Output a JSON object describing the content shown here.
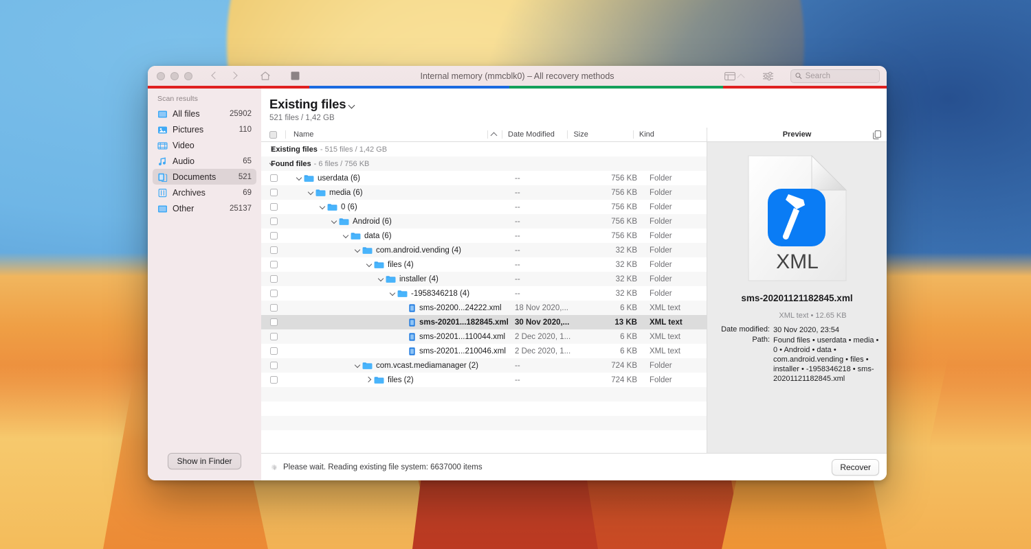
{
  "window": {
    "title": "Internal memory (mmcblk0) – All recovery methods",
    "traffic_lights": [
      "close",
      "minimize",
      "zoom"
    ],
    "toolbar": {
      "back_icon": "chevron-left-icon",
      "forward_icon": "chevron-right-icon",
      "home_icon": "home-icon",
      "stop_icon": "stop-icon",
      "view_icon": "view-options-icon",
      "view_caret": "chevron-down-icon",
      "filter_icon": "filter-sliders-icon",
      "search_icon": "search-icon",
      "search_placeholder": "Search",
      "search_value": ""
    },
    "progress_segments": [
      {
        "color": "#e02020",
        "width_pct": 21.9
      },
      {
        "color": "#1a6ae0",
        "width_pct": 27.0
      },
      {
        "color": "#14a05a",
        "width_pct": 29.0
      },
      {
        "color": "#e02020",
        "width_pct": 22.1
      }
    ]
  },
  "sidebar": {
    "header": "Scan results",
    "items": [
      {
        "label": "All files",
        "count": "25902",
        "icon": "all-files-icon",
        "selected": false
      },
      {
        "label": "Pictures",
        "count": "110",
        "icon": "pictures-icon",
        "selected": false
      },
      {
        "label": "Video",
        "count": "",
        "icon": "video-icon",
        "selected": false
      },
      {
        "label": "Audio",
        "count": "65",
        "icon": "audio-icon",
        "selected": false
      },
      {
        "label": "Documents",
        "count": "521",
        "icon": "documents-icon",
        "selected": true
      },
      {
        "label": "Archives",
        "count": "69",
        "icon": "archives-icon",
        "selected": false
      },
      {
        "label": "Other",
        "count": "25137",
        "icon": "other-icon",
        "selected": false
      }
    ],
    "show_in_finder_label": "Show in Finder"
  },
  "main": {
    "page_title": "Existing files",
    "title_caret": "chevron-down-icon",
    "subtitle": "521 files / 1,42 GB",
    "columns": {
      "name": "Name",
      "date_modified": "Date Modified",
      "size": "Size",
      "kind": "Kind",
      "sort_indicator": "caret-up-icon"
    },
    "groups": [
      {
        "title": "Existing files",
        "sub": "- 515 files / 1,42 GB",
        "expanded": false
      },
      {
        "title": "Found files",
        "sub": "- 6 files / 756 KB",
        "expanded": true
      }
    ],
    "rows": [
      {
        "indent": 0,
        "name": "userdata (6)",
        "date": "--",
        "size": "756 KB",
        "kind": "Folder",
        "type": "folder",
        "expanded": true,
        "selected": false
      },
      {
        "indent": 1,
        "name": "media (6)",
        "date": "--",
        "size": "756 KB",
        "kind": "Folder",
        "type": "folder",
        "expanded": true,
        "selected": false
      },
      {
        "indent": 2,
        "name": "0 (6)",
        "date": "--",
        "size": "756 KB",
        "kind": "Folder",
        "type": "folder",
        "expanded": true,
        "selected": false
      },
      {
        "indent": 3,
        "name": "Android (6)",
        "date": "--",
        "size": "756 KB",
        "kind": "Folder",
        "type": "folder",
        "expanded": true,
        "selected": false
      },
      {
        "indent": 4,
        "name": "data (6)",
        "date": "--",
        "size": "756 KB",
        "kind": "Folder",
        "type": "folder",
        "expanded": true,
        "selected": false
      },
      {
        "indent": 5,
        "name": "com.android.vending (4)",
        "date": "--",
        "size": "32 KB",
        "kind": "Folder",
        "type": "folder",
        "expanded": true,
        "selected": false
      },
      {
        "indent": 6,
        "name": "files (4)",
        "date": "--",
        "size": "32 KB",
        "kind": "Folder",
        "type": "folder",
        "expanded": true,
        "selected": false
      },
      {
        "indent": 7,
        "name": "installer (4)",
        "date": "--",
        "size": "32 KB",
        "kind": "Folder",
        "type": "folder",
        "expanded": true,
        "selected": false
      },
      {
        "indent": 8,
        "name": "-1958346218 (4)",
        "date": "--",
        "size": "32 KB",
        "kind": "Folder",
        "type": "folder",
        "expanded": true,
        "selected": false
      },
      {
        "indent": 9,
        "name": "sms-20200...24222.xml",
        "date": "18 Nov 2020,...",
        "size": "6 KB",
        "kind": "XML text",
        "type": "xml",
        "expanded": null,
        "selected": false
      },
      {
        "indent": 9,
        "name": "sms-20201...182845.xml",
        "date": "30 Nov 2020,...",
        "size": "13 KB",
        "kind": "XML text",
        "type": "xml",
        "expanded": null,
        "selected": true
      },
      {
        "indent": 9,
        "name": "sms-20201...110044.xml",
        "date": "2 Dec 2020, 1...",
        "size": "6 KB",
        "kind": "XML text",
        "type": "xml",
        "expanded": null,
        "selected": false
      },
      {
        "indent": 9,
        "name": "sms-20201...210046.xml",
        "date": "2 Dec 2020, 1...",
        "size": "6 KB",
        "kind": "XML text",
        "type": "xml",
        "expanded": null,
        "selected": false
      },
      {
        "indent": 5,
        "name": "com.vcast.mediamanager (2)",
        "date": "--",
        "size": "724 KB",
        "kind": "Folder",
        "type": "folder",
        "expanded": true,
        "selected": false
      },
      {
        "indent": 6,
        "name": "files (2)",
        "date": "--",
        "size": "724 KB",
        "kind": "Folder",
        "type": "folder",
        "expanded": false,
        "selected": false
      }
    ]
  },
  "preview": {
    "header": "Preview",
    "copy_icon": "copy-icon",
    "file_icon": {
      "badge": "XML",
      "glyph": "hammer-icon",
      "badge_color": "#0a7cf5"
    },
    "filename": "sms-20201121182845.xml",
    "kind_and_size": "XML text • 12.65 KB",
    "meta": [
      {
        "key": "Date modified:",
        "value": "30 Nov 2020, 23:54"
      },
      {
        "key": "Path:",
        "value": "Found files • userdata • media • 0 • Android • data • com.android.vending • files • installer • -1958346218 • sms-20201121182845.xml"
      }
    ]
  },
  "footer": {
    "spinner_icon": "loading-spinner-icon",
    "status": "Please wait. Reading existing file system: 6637000 items",
    "recover_label": "Recover"
  }
}
